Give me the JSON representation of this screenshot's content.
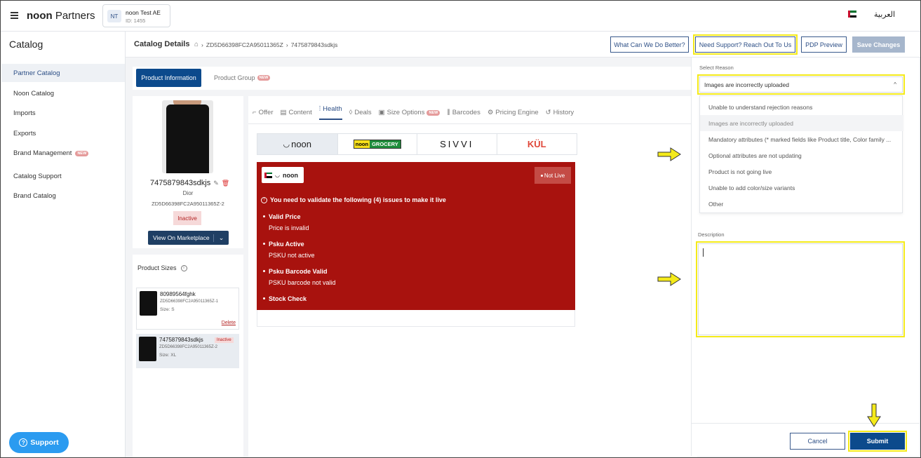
{
  "header": {
    "brand_bold": "noon",
    "brand_light": "Partners",
    "account_initials": "NT",
    "account_name": "noon Test AE",
    "account_id": "ID: 1455",
    "language": "العربية"
  },
  "sidebar": {
    "title": "Catalog",
    "items": [
      {
        "label": "Partner Catalog",
        "active": true
      },
      {
        "label": "Noon Catalog"
      },
      {
        "label": "Imports"
      },
      {
        "label": "Exports"
      },
      {
        "label": "Brand Management",
        "badge": "NEW"
      },
      {
        "label": "Catalog Support"
      },
      {
        "label": "Brand Catalog"
      }
    ],
    "support_button": "Support"
  },
  "breadcrumb": {
    "title": "Catalog Details",
    "sku_path": "ZD5D66398FC2A95011365Z",
    "sku": "7475879843sdkjs"
  },
  "toolbar": {
    "feedback": "What Can We Do Better?",
    "support": "Need Support? Reach Out To Us",
    "preview": "PDP Preview",
    "save": "Save Changes"
  },
  "tabs": {
    "product_info": "Product Information",
    "product_group": "Product Group",
    "new_badge": "NEW"
  },
  "product": {
    "sku": "7475879843sdkjs",
    "brand": "Dior",
    "parent_sku": "ZD5D66398FC2A95011365Z-2",
    "status": "Inactive",
    "view_button": "View On Marketplace"
  },
  "sizes": {
    "title": "Product Sizes",
    "items": [
      {
        "sku": "80989564fghk",
        "code": "ZD5D66398FC2A95011365Z-1",
        "size": "Size: S",
        "action": "Delete"
      },
      {
        "sku": "7475879843sdkjs",
        "code": "ZD5D66398FC2A95011365Z-2",
        "size": "Size: XL",
        "status": "Inactive"
      }
    ]
  },
  "subtabs": [
    "Offer",
    "Content",
    "Health",
    "Deals",
    "Size Options",
    "Barcodes",
    "Pricing Engine",
    "History"
  ],
  "stores": {
    "noon": "noon",
    "grocery_left": "noon",
    "grocery_right": "GROCERY",
    "sivvi": "SIVVI",
    "kul": "KÜL"
  },
  "health": {
    "store_label": "noon",
    "status": "Not Live",
    "message": "You need to validate the following (4) issues to make it live",
    "issues": [
      {
        "title": "Valid Price",
        "detail": "Price is invalid"
      },
      {
        "title": "Psku Active",
        "detail": "PSKU not active"
      },
      {
        "title": "Psku Barcode Valid",
        "detail": "PSKU barcode not valid"
      },
      {
        "title": "Stock Check",
        "detail": ""
      }
    ]
  },
  "panel": {
    "reason_label": "Select Reason",
    "reason_value": "Images are incorrectly uploaded",
    "options": [
      "Unable to understand rejection reasons",
      "Images are incorrectly uploaded",
      "Mandatory attributes (* marked fields like Product title, Color family ...",
      "Optional attributes are not updating",
      "Product is not going live",
      "Unable to add color/size variants",
      "Other"
    ],
    "description_label": "Description",
    "description_value": "",
    "cancel": "Cancel",
    "submit": "Submit"
  },
  "colors": {
    "primary": "#0c4a8c",
    "health_red": "#a8120e",
    "highlight": "#f4ea1a",
    "inactive_bg": "#f6d9d9",
    "support_btn": "#2b9bf0"
  }
}
